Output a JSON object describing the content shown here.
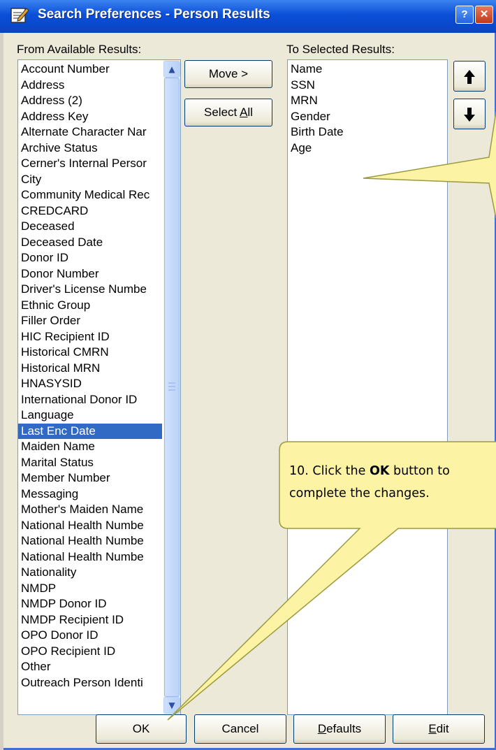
{
  "window": {
    "title": "Search Preferences - Person Results",
    "help_label": "?",
    "close_label": "✕"
  },
  "available": {
    "label": "From Available Results:",
    "selected_item": "Last Enc Date",
    "items": [
      "Account Number",
      "Address",
      "Address (2)",
      "Address Key",
      "Alternate Character Nar",
      "Archive Status",
      "Cerner's Internal Persor",
      "City",
      "Community Medical Rec",
      "CREDCARD",
      "Deceased",
      "Deceased Date",
      "Donor ID",
      "Donor Number",
      "Driver's License Numbe",
      "Ethnic Group",
      "Filler Order",
      "HIC Recipient ID",
      "Historical CMRN",
      "Historical MRN",
      "HNASYSID",
      "International Donor ID",
      "Language",
      "Last Enc Date",
      "Maiden Name",
      "Marital Status",
      "Member Number",
      "Messaging",
      "Mother's Maiden Name",
      "National Health Numbe",
      "National Health Numbe",
      "National Health Numbe",
      "Nationality",
      "NMDP",
      "NMDP Donor ID",
      "NMDP Recipient ID",
      "OPO Donor ID",
      "OPO Recipient ID",
      "Other",
      "Outreach Person Identi"
    ]
  },
  "selected": {
    "label": "To Selected Results:",
    "items": [
      "Name",
      "SSN",
      "MRN",
      "Gender",
      "Birth Date",
      "Age"
    ]
  },
  "buttons": {
    "move": "Move >",
    "select_all": "Select All",
    "up_arrow": "🡅",
    "down_arrow": "🡇",
    "ok": "OK",
    "cancel": "Cancel",
    "defaults": "Defaults",
    "edit": "Edit"
  },
  "callout": {
    "step": "10. Click the",
    "bold": "OK",
    "rest1": "button to",
    "line2": "complete the changes."
  },
  "colors": {
    "selection": "#316ac5",
    "callout_fill": "#fdf3a4",
    "callout_border": "#9a9a40",
    "title_bar": "#0a4fd8"
  }
}
